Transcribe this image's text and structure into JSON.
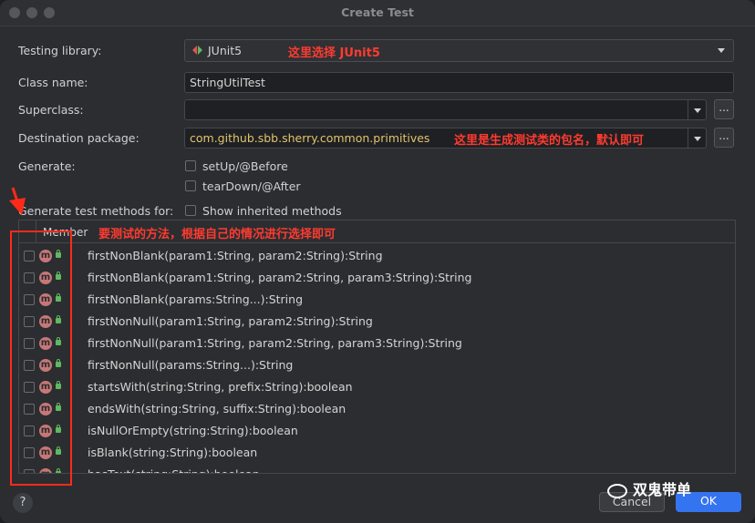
{
  "window": {
    "title": "Create Test"
  },
  "form": {
    "testing_library_label": "Testing library:",
    "testing_library_value": "JUnit5",
    "class_name_label": "Class name:",
    "class_name_value": "StringUtilTest",
    "superclass_label": "Superclass:",
    "superclass_value": "",
    "destination_package_label": "Destination package:",
    "destination_package_value": "com.github.sbb.sherry.common.primitives",
    "generate_label": "Generate:",
    "setup_label": "setUp/@Before",
    "teardown_label": "tearDown/@After",
    "methods_label": "Generate test methods for:",
    "show_inherited_label": "Show inherited methods",
    "browse_label": "..."
  },
  "annotations": {
    "library_note": "这里选择 JUnit5",
    "package_note": "这里是生成测试类的包名，默认即可",
    "methods_note": "要测试的方法，根据自己的情况进行选择即可"
  },
  "table": {
    "column_header": "Member",
    "member_icon_letter": "m",
    "rows": [
      "firstNonBlank(param1:String, param2:String):String",
      "firstNonBlank(param1:String, param2:String, param3:String):String",
      "firstNonBlank(params:String...):String",
      "firstNonNull(param1:String, param2:String):String",
      "firstNonNull(param1:String, param2:String, param3:String):String",
      "firstNonNull(params:String...):String",
      "startsWith(string:String, prefix:String):boolean",
      "endsWith(string:String, suffix:String):boolean",
      "isNullOrEmpty(string:String):boolean",
      "isBlank(string:String):boolean",
      "hasText(string:String):boolean"
    ]
  },
  "footer": {
    "help_label": "?",
    "cancel_label": "Cancel",
    "ok_label": "OK",
    "watermark": "双鬼带单"
  },
  "colors": {
    "annotation": "#ff3b30",
    "package_text": "#e0c46c",
    "ok_button": "#3574f0"
  }
}
